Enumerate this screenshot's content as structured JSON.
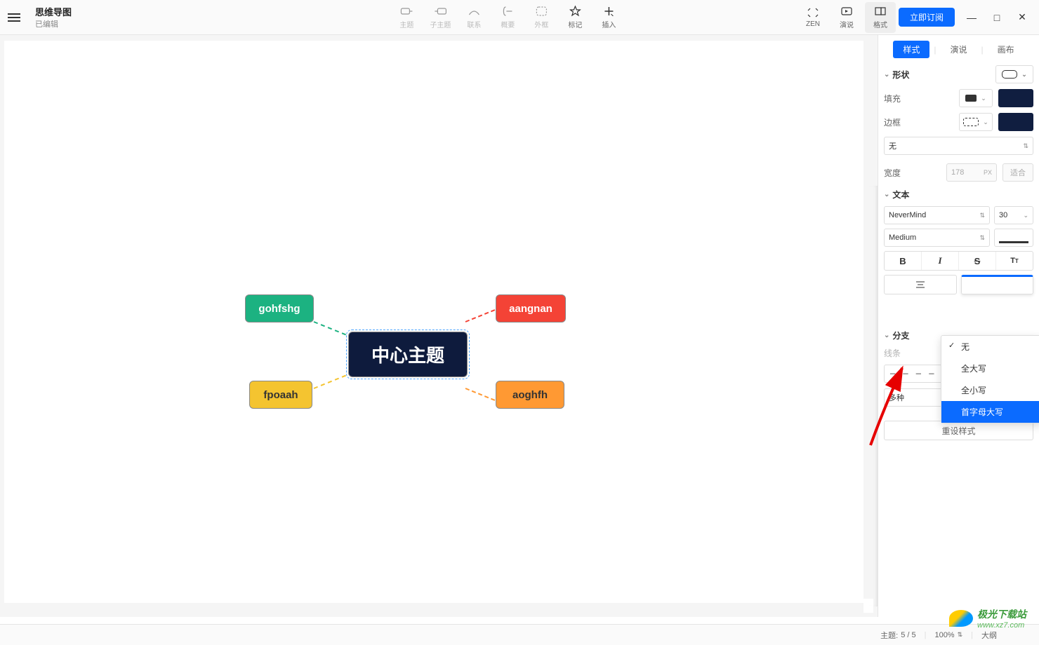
{
  "header": {
    "title": "思维导图",
    "subtitle": "已编辑"
  },
  "toolbar": {
    "items": [
      {
        "label": "主题",
        "icon": "topic"
      },
      {
        "label": "子主题",
        "icon": "subtopic"
      },
      {
        "label": "联系",
        "icon": "link"
      },
      {
        "label": "概要",
        "icon": "summary"
      },
      {
        "label": "外框",
        "icon": "boundary"
      },
      {
        "label": "标记",
        "icon": "star"
      },
      {
        "label": "插入",
        "icon": "plus"
      }
    ],
    "right": [
      {
        "label": "ZEN",
        "icon": "zen"
      },
      {
        "label": "演说",
        "icon": "present"
      },
      {
        "label": "格式",
        "icon": "format"
      }
    ],
    "subscribe": "立即订阅"
  },
  "window_controls": {
    "minimize": "—",
    "maximize": "□",
    "close": "✕"
  },
  "mindmap": {
    "center": "中心主题",
    "nodes": [
      {
        "text": "gohfshg",
        "color": "green"
      },
      {
        "text": "fpoaah",
        "color": "yellow"
      },
      {
        "text": "aangnan",
        "color": "red"
      },
      {
        "text": "aoghfh",
        "color": "orange"
      }
    ]
  },
  "panel": {
    "tabs": [
      "样式",
      "演说",
      "画布"
    ],
    "active_tab": 0,
    "shape_section": "形状",
    "fill_label": "填充",
    "border_label": "边框",
    "border_style_value": "无",
    "width_label": "宽度",
    "width_value": "178",
    "width_unit": "PX",
    "fit_label": "适合",
    "text_section": "文本",
    "font_family": "NeverMind",
    "font_size": "30",
    "font_weight": "Medium",
    "text_case_dropdown": {
      "items": [
        "无",
        "全大写",
        "全小写",
        "首字母大写"
      ],
      "checked": 0,
      "highlighted": 3
    },
    "branch_section": "分支",
    "line_label": "线条",
    "multi_value": "多种",
    "reset_label": "重设样式"
  },
  "statusbar": {
    "topic_label": "主题:",
    "topic_count": "5 / 5",
    "zoom": "100%",
    "outline": "大纲"
  },
  "watermark": {
    "name": "极光下载站",
    "url": "www.xz7.com"
  }
}
